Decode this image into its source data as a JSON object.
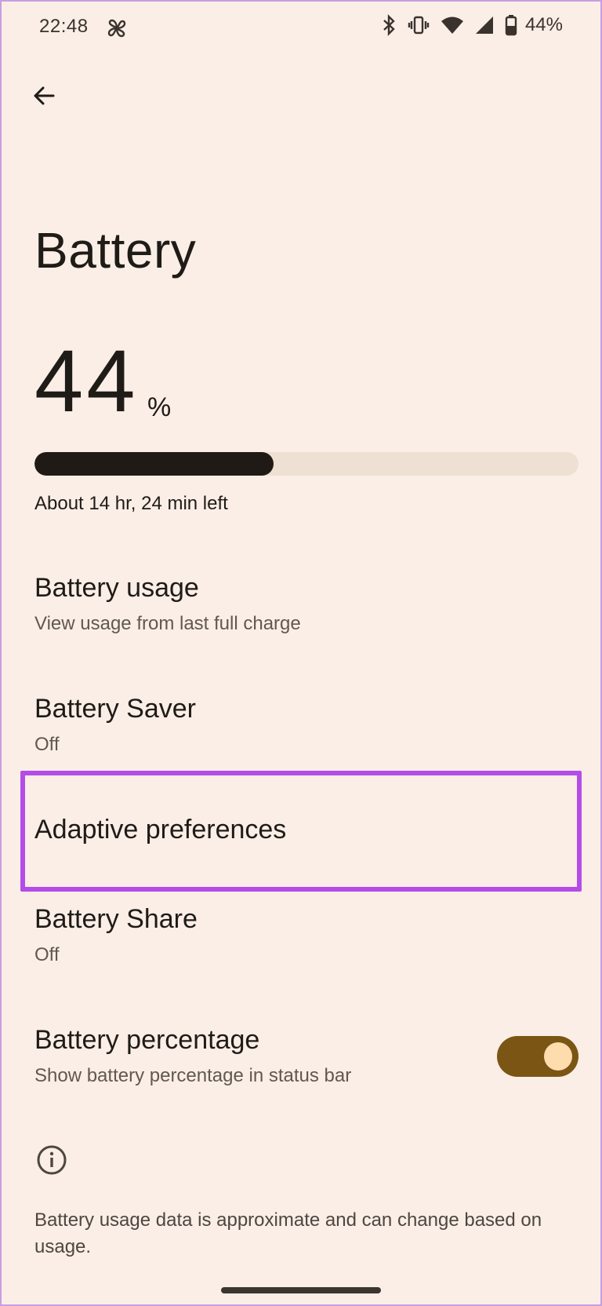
{
  "status_bar": {
    "time": "22:48",
    "battery_percent_text": "44%",
    "icons": [
      "fan-icon",
      "bluetooth-icon",
      "vibrate-icon",
      "wifi-icon",
      "signal-icon",
      "battery-icon"
    ]
  },
  "header": {
    "back_icon": "arrow-back-icon",
    "title": "Battery"
  },
  "battery": {
    "percent_value": "44",
    "percent_sign": "%",
    "level_fraction": 0.44,
    "time_left": "About 14 hr, 24 min left"
  },
  "items": [
    {
      "title": "Battery usage",
      "subtitle": "View usage from last full charge"
    },
    {
      "title": "Battery Saver",
      "subtitle": "Off"
    },
    {
      "title": "Adaptive preferences",
      "subtitle": ""
    },
    {
      "title": "Battery Share",
      "subtitle": "Off"
    },
    {
      "title": "Battery percentage",
      "subtitle": "Show battery percentage in status bar",
      "toggle_on": true
    }
  ],
  "footer": {
    "info_icon": "info-icon",
    "text": "Battery usage data is approximate and can change based on usage."
  },
  "colors": {
    "background": "#faeee6",
    "highlight": "#b44de8",
    "toggle_track": "#7b5514",
    "toggle_knob": "#ffdcae",
    "bar_fill": "#201a17",
    "bar_track": "#eee0d2"
  }
}
